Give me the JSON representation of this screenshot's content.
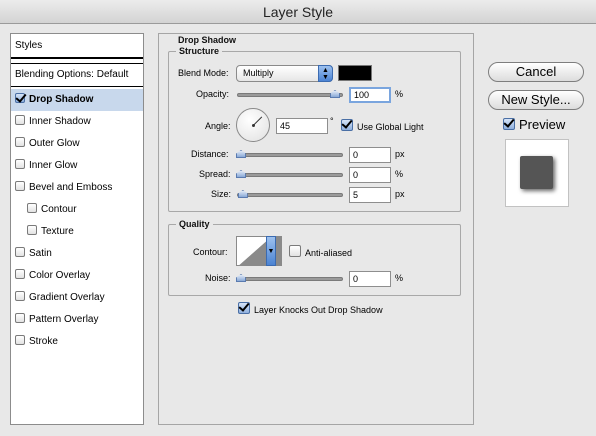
{
  "window": {
    "title": "Layer Style"
  },
  "sidebar": {
    "header": "Styles",
    "blending": "Blending Options: Default",
    "items": [
      {
        "label": "Drop Shadow",
        "checked": true,
        "selected": true,
        "indent": false
      },
      {
        "label": "Inner Shadow",
        "checked": false,
        "selected": false,
        "indent": false
      },
      {
        "label": "Outer Glow",
        "checked": false,
        "selected": false,
        "indent": false
      },
      {
        "label": "Inner Glow",
        "checked": false,
        "selected": false,
        "indent": false
      },
      {
        "label": "Bevel and Emboss",
        "checked": false,
        "selected": false,
        "indent": false
      },
      {
        "label": "Contour",
        "checked": false,
        "selected": false,
        "indent": true
      },
      {
        "label": "Texture",
        "checked": false,
        "selected": false,
        "indent": true
      },
      {
        "label": "Satin",
        "checked": false,
        "selected": false,
        "indent": false
      },
      {
        "label": "Color Overlay",
        "checked": false,
        "selected": false,
        "indent": false
      },
      {
        "label": "Gradient Overlay",
        "checked": false,
        "selected": false,
        "indent": false
      },
      {
        "label": "Pattern Overlay",
        "checked": false,
        "selected": false,
        "indent": false
      },
      {
        "label": "Stroke",
        "checked": false,
        "selected": false,
        "indent": false
      }
    ]
  },
  "drop_shadow": {
    "title": "Drop Shadow",
    "structure": {
      "title": "Structure",
      "blend_mode_label": "Blend Mode:",
      "blend_mode_value": "Multiply",
      "shadow_color": "#000000",
      "opacity_label": "Opacity:",
      "opacity_value": "100",
      "opacity_unit": "%",
      "opacity_level": 1.0,
      "angle_label": "Angle:",
      "angle_value": "45",
      "angle_unit": "°",
      "use_global_light_label": "Use Global Light",
      "use_global_light": true,
      "distance_label": "Distance:",
      "distance_value": "0",
      "distance_unit": "px",
      "distance_level": 0,
      "spread_label": "Spread:",
      "spread_value": "0",
      "spread_unit": "%",
      "spread_level": 0,
      "size_label": "Size:",
      "size_value": "5",
      "size_unit": "px",
      "size_level": 0.02
    },
    "quality": {
      "title": "Quality",
      "contour_label": "Contour:",
      "anti_aliased_label": "Anti-aliased",
      "anti_aliased": false,
      "noise_label": "Noise:",
      "noise_value": "0",
      "noise_unit": "%",
      "noise_level": 0
    },
    "knockout_label": "Layer Knocks Out Drop Shadow",
    "knockout": true
  },
  "actions": {
    "cancel_label": "Cancel",
    "new_style_label": "New Style...",
    "preview_label": "Preview",
    "preview_checked": true
  },
  "colors": {
    "selection": "#c8d8ec",
    "accent": "#4b83d3"
  }
}
